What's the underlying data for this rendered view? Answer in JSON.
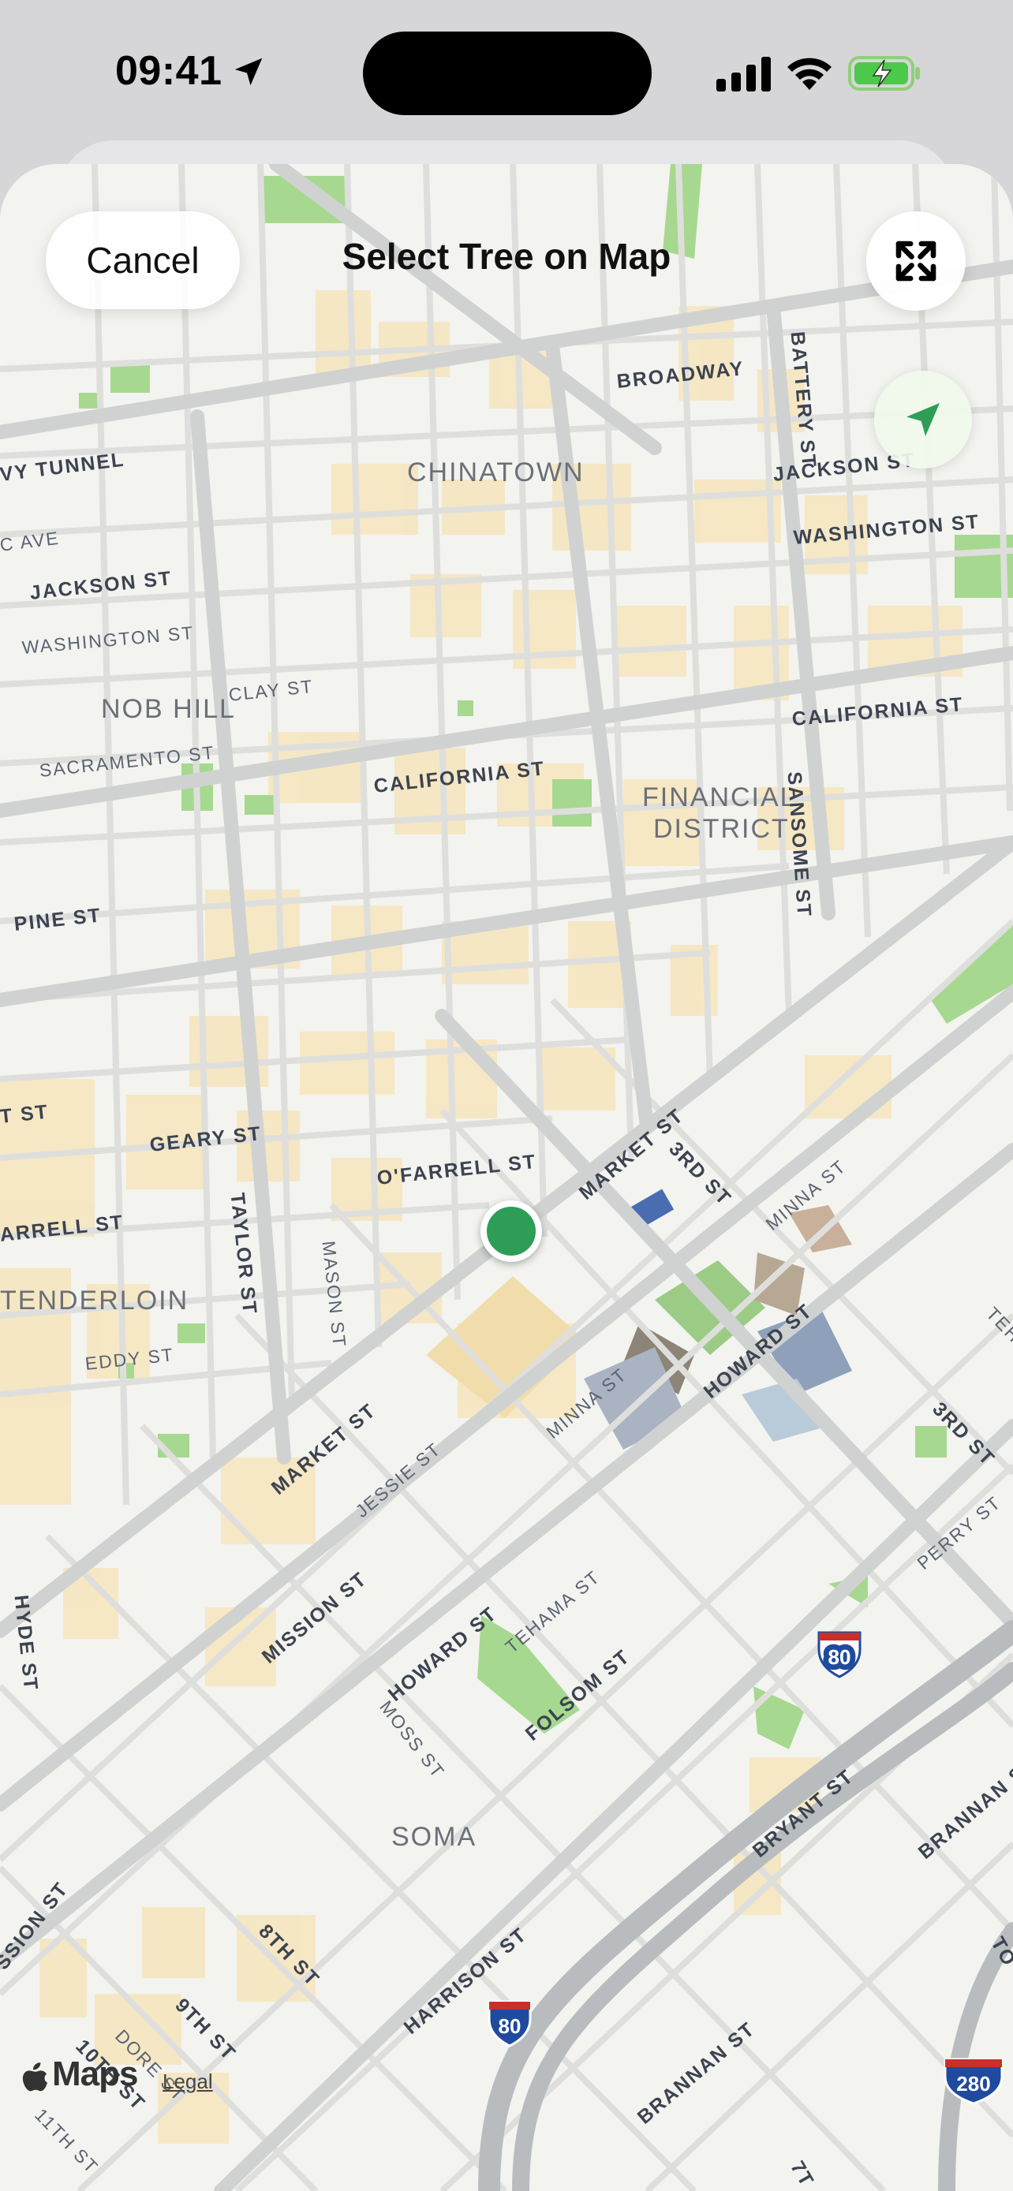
{
  "status_bar": {
    "time": "09:41"
  },
  "header": {
    "cancel_label": "Cancel",
    "title": "Select Tree on Map"
  },
  "icons": {
    "expand": "expand-arrows-icon",
    "locate": "location-arrow-icon",
    "status_location": "location-arrow-icon",
    "signal": "cellular-signal-icon",
    "wifi": "wifi-icon",
    "battery": "battery-charging-icon"
  },
  "map": {
    "neighborhoods": [
      "CHINATOWN",
      "NOB HILL",
      "FINANCIAL",
      "DISTRICT",
      "TENDERLOIN",
      "SOMA"
    ],
    "streets": [
      "BROADWAY",
      "BATTERY ST",
      "JACKSON ST",
      "WASHINGTON ST",
      "VY TUNNEL",
      "C AVE",
      "JACKSON ST",
      "WASHINGTON ST",
      "CLAY ST",
      "CALIFORNIA ST",
      "SACRAMENTO ST",
      "CALIFORNIA ST",
      "SANSOME ST",
      "PINE ST",
      "T ST",
      "GEARY ST",
      "TAYLOR ST",
      "O'FARRELL ST",
      "MARKET ST",
      "3RD ST",
      "MINNA ST",
      "ARRELL ST",
      "MASON ST",
      "EDDY ST",
      "HOWARD ST",
      "MINNA ST",
      "3RD ST",
      "TEH",
      "MARKET ST",
      "JESSIE ST",
      "PERRY ST",
      "MISSION ST",
      "HOWARD ST",
      "TEHAMA ST",
      "FOLSOM ST",
      "HYDE ST",
      "MOSS ST",
      "BRYANT ST",
      "BRANNAN S",
      "SSION ST",
      "8TH ST",
      "HARRISON ST",
      "9TH ST",
      "DORE ST",
      "10TH ST",
      "11TH ST",
      "BRANNAN ST",
      "7T",
      "TO"
    ],
    "highway_shields": [
      "80",
      "80",
      "280"
    ],
    "colors": {
      "background": "#f3f3f0",
      "block_tan": "#f6e5bc",
      "park_green": "#a7d88f",
      "pin_green": "#2e9e57",
      "street_text": "#3c4350"
    }
  },
  "attribution": {
    "maps_label": "Maps",
    "legal_label": "Legal"
  }
}
